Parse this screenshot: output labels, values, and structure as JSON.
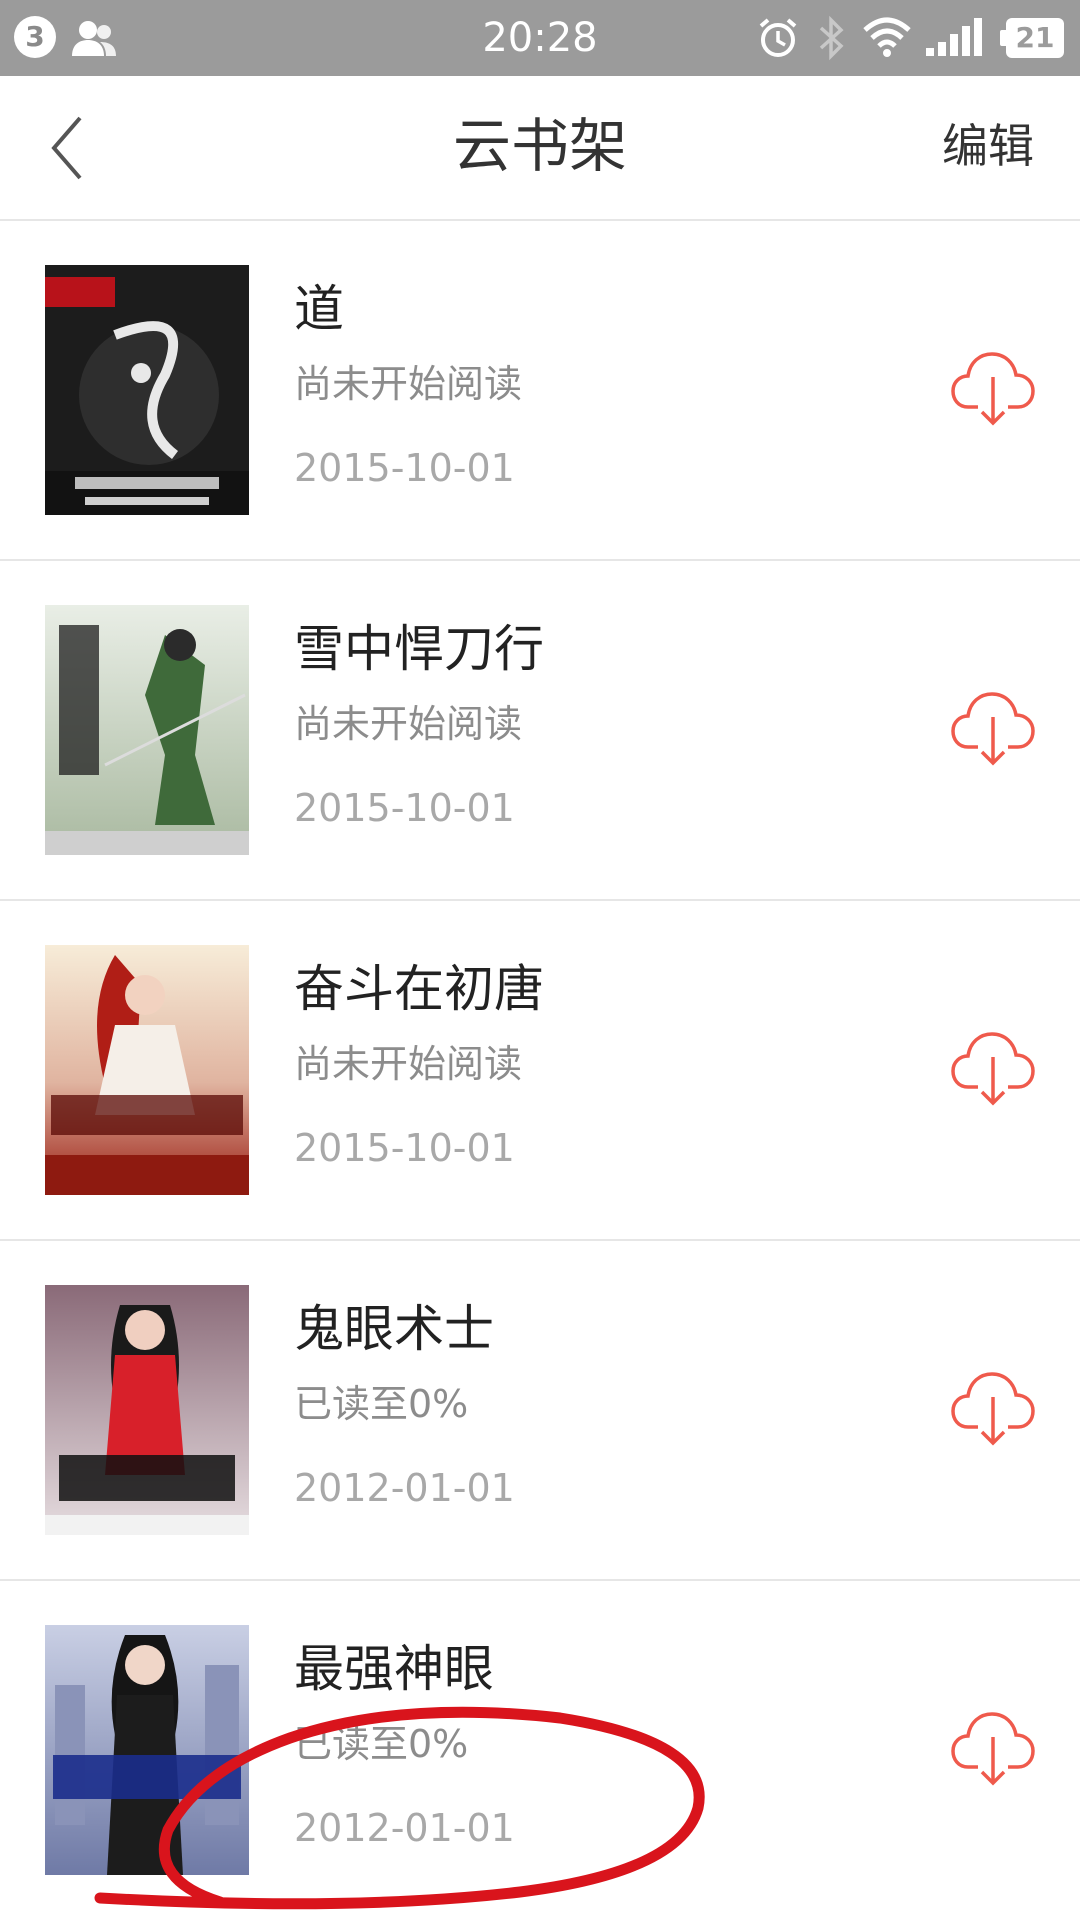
{
  "status_bar": {
    "notification_count": "3",
    "time": "20:28",
    "battery": "21",
    "icons": [
      "contacts-icon",
      "alarm-icon",
      "bluetooth-icon",
      "wifi-icon",
      "signal-icon",
      "battery-icon"
    ]
  },
  "header": {
    "title": "云书架",
    "edit_label": "编辑",
    "back_icon": "chevron-left-icon"
  },
  "books": [
    {
      "title": "道",
      "status": "尚未开始阅读",
      "date": "2015-10-01",
      "cover_colors": [
        "#1a1a1a",
        "#3a3a3a"
      ]
    },
    {
      "title": "雪中悍刀行",
      "status": "尚未开始阅读",
      "date": "2015-10-01",
      "cover_colors": [
        "#dfe6dc",
        "#6e8f5e"
      ]
    },
    {
      "title": "奋斗在初唐",
      "status": "尚未开始阅读",
      "date": "2015-10-01",
      "cover_colors": [
        "#f4e8d2",
        "#b02418"
      ]
    },
    {
      "title": "鬼眼术士",
      "status": "已读至0%",
      "date": "2012-01-01",
      "cover_colors": [
        "#c6a9b6",
        "#d8202a"
      ]
    },
    {
      "title": "最强神眼",
      "status": "已读至0%",
      "date": "2012-01-01",
      "cover_colors": [
        "#b8bfd6",
        "#1b2d8c"
      ]
    }
  ],
  "colors": {
    "status_bar_bg": "#9b9b9b",
    "accent_red": "#ef5a4c",
    "annotation_red": "#d9141c",
    "divider": "#e6e6e6"
  }
}
